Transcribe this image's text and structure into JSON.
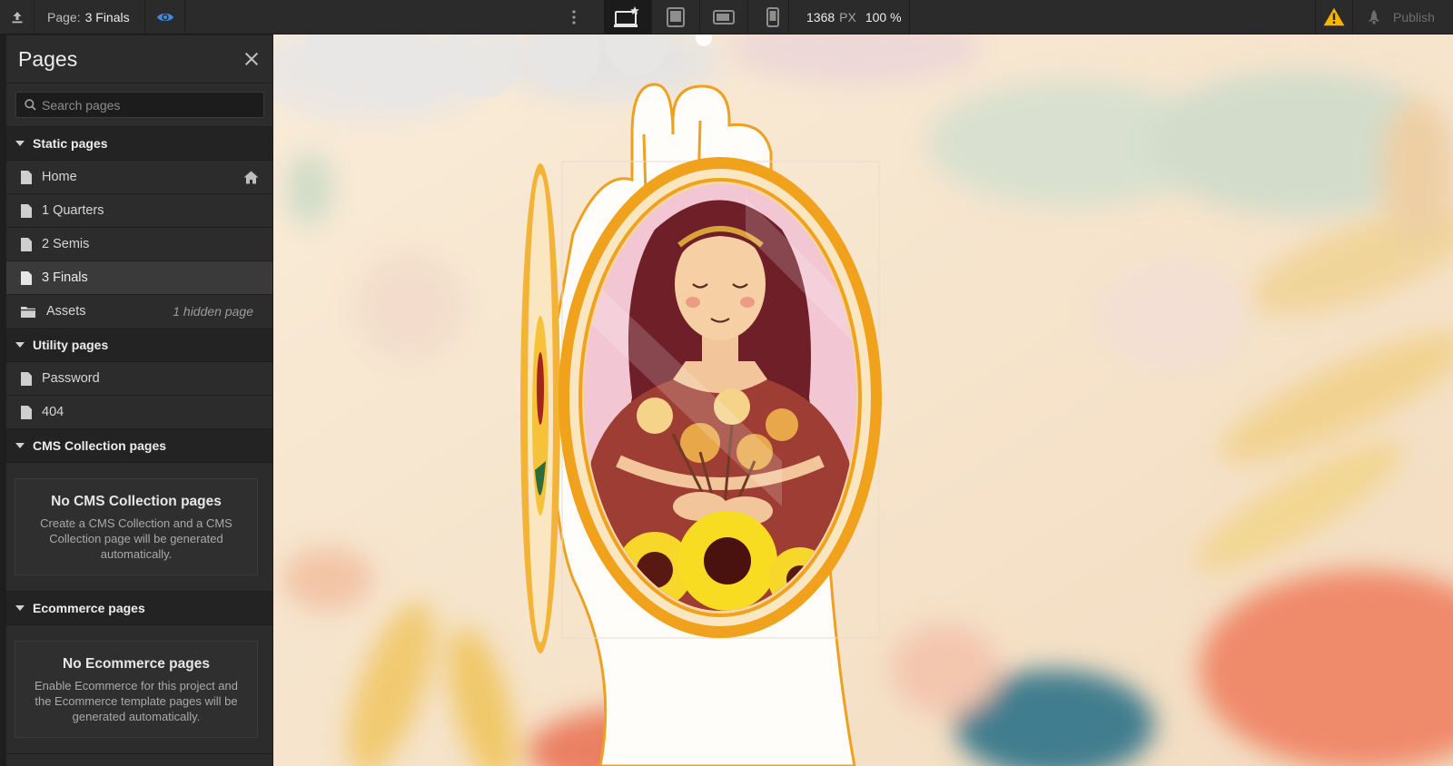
{
  "toolbar": {
    "page_label": "Page:",
    "page_name": "3 Finals",
    "width_value": "1368",
    "width_unit": "PX",
    "zoom": "100 %",
    "publish_label": "Publish"
  },
  "panel": {
    "title": "Pages",
    "search_placeholder": "Search pages",
    "static_section": "Static pages",
    "static_pages": [
      {
        "label": "Home"
      },
      {
        "label": "1 Quarters"
      },
      {
        "label": "2 Semis"
      },
      {
        "label": "3 Finals"
      }
    ],
    "assets_label": "Assets",
    "assets_hint": "1 hidden page",
    "utility_section": "Utility pages",
    "utility_pages": [
      {
        "label": "Password"
      },
      {
        "label": "404"
      }
    ],
    "cms_section": "CMS Collection pages",
    "cms_empty_title": "No CMS Collection pages",
    "cms_empty_desc": "Create a CMS Collection and a CMS Collection page will be generated automatically.",
    "ecom_section": "Ecommerce pages",
    "ecom_empty_title": "No Ecommerce pages",
    "ecom_empty_desc": "Enable Ecommerce for this project and the Ecommerce template pages will be generated automatically."
  },
  "colors": {
    "accent_blue": "#3b8be0",
    "warning": "#f5b400",
    "frame_orange": "#f0a21c"
  },
  "icons": {
    "export": "upload-icon",
    "preview": "eye-icon",
    "more": "vertical-dots-icon",
    "desktop_star": "desktop-star-icon",
    "tablet": "tablet-icon",
    "mobile_landscape": "mobile-landscape-icon",
    "mobile_portrait": "mobile-portrait-icon",
    "warning": "warning-icon",
    "publish": "rocket-icon",
    "close": "close-icon",
    "search": "search-icon",
    "home": "home-icon"
  }
}
